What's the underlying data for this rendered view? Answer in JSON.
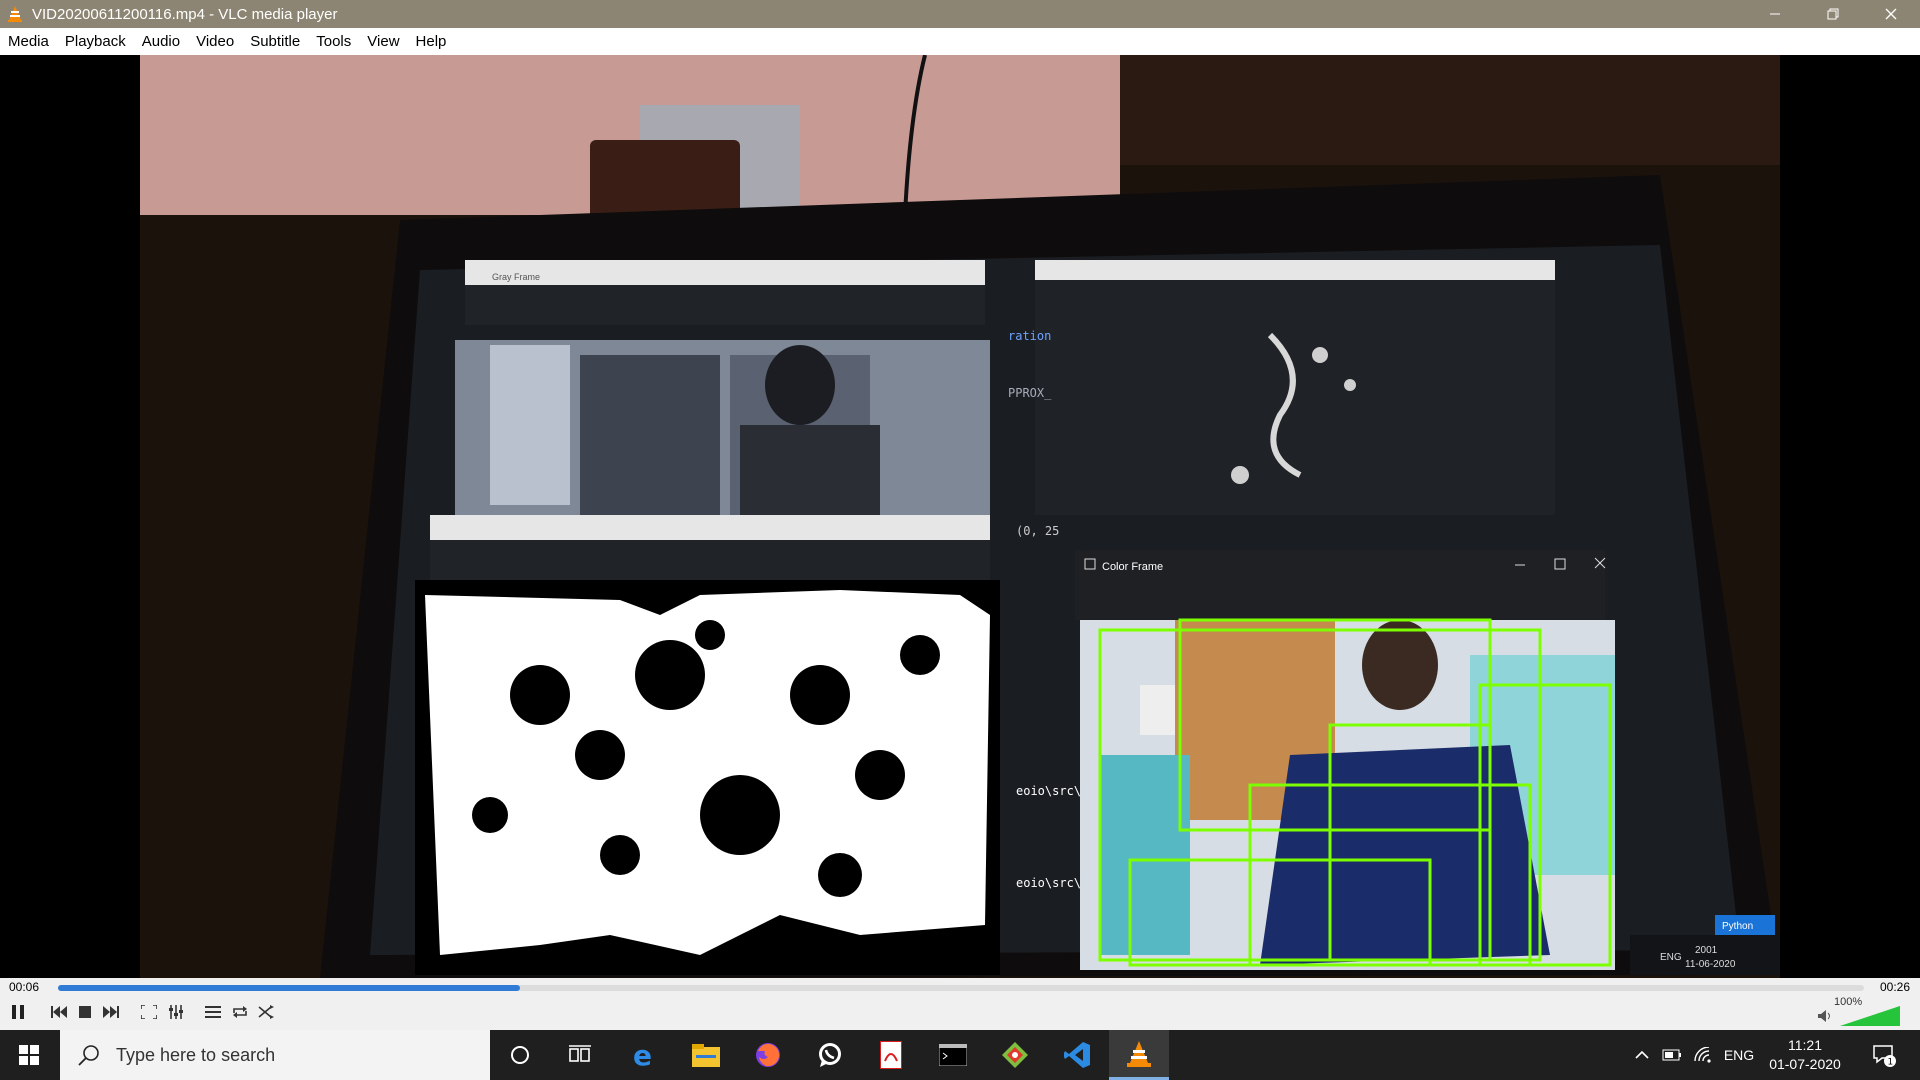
{
  "window": {
    "title": "VID20200611200116.mp4 - VLC media player"
  },
  "menu": [
    "Media",
    "Playback",
    "Audio",
    "Video",
    "Subtitle",
    "Tools",
    "View",
    "Help"
  ],
  "video_content": {
    "gray_window_title": "Gray Frame",
    "color_window_title": "Color Frame",
    "code_fragments": [
      "ration",
      "PPROX_",
      "(0, 25",
      "eoio\\src\\ca",
      "eoio\\src\\ca"
    ],
    "screen_tray": {
      "lang": "ENG",
      "time": "2001",
      "date": "11-06-2020",
      "app_badge": "Python"
    }
  },
  "player": {
    "elapsed": "00:06",
    "total": "00:26",
    "progress": 0.256,
    "volume": "100%",
    "volume_level": 1.0
  },
  "taskbar": {
    "search_placeholder": "Type here to search",
    "apps": [
      "task-view",
      "edge",
      "file-explorer",
      "firefox",
      "whatsapp",
      "pdf-reader",
      "terminal",
      "git",
      "vscode",
      "vlc"
    ],
    "lang": "ENG",
    "time": "11:21",
    "date": "01-07-2020",
    "notification_count": "1"
  },
  "colors": {
    "accent": "#2f7bd6",
    "detect_box": "#7cff00",
    "titlebar": "#8d8573",
    "taskbar": "#1f1f1f"
  }
}
